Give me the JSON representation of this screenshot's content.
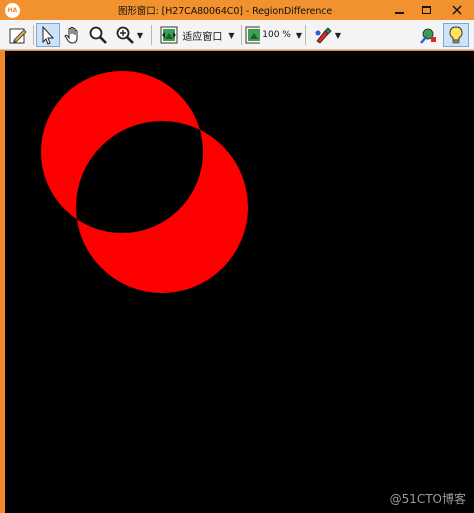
{
  "window": {
    "title": "图形窗口: [H27CA80064C0] - RegionDifference",
    "app_icon_text": "HA",
    "frame_color": "#f08a2c"
  },
  "toolbar": {
    "fit_window_label": "适应窗口",
    "zoom_label": "100 %",
    "tools": [
      "edit-icon",
      "pointer-icon",
      "hand-icon",
      "magnifier-icon",
      "zoom-in-icon",
      "fit-window-icon",
      "zoom-percent-icon",
      "paint-icon",
      "marker-icon",
      "lightbulb-icon"
    ]
  },
  "canvas": {
    "background": "#000000",
    "region_color": "#ff0000"
  },
  "watermark": "@51CTO博客"
}
